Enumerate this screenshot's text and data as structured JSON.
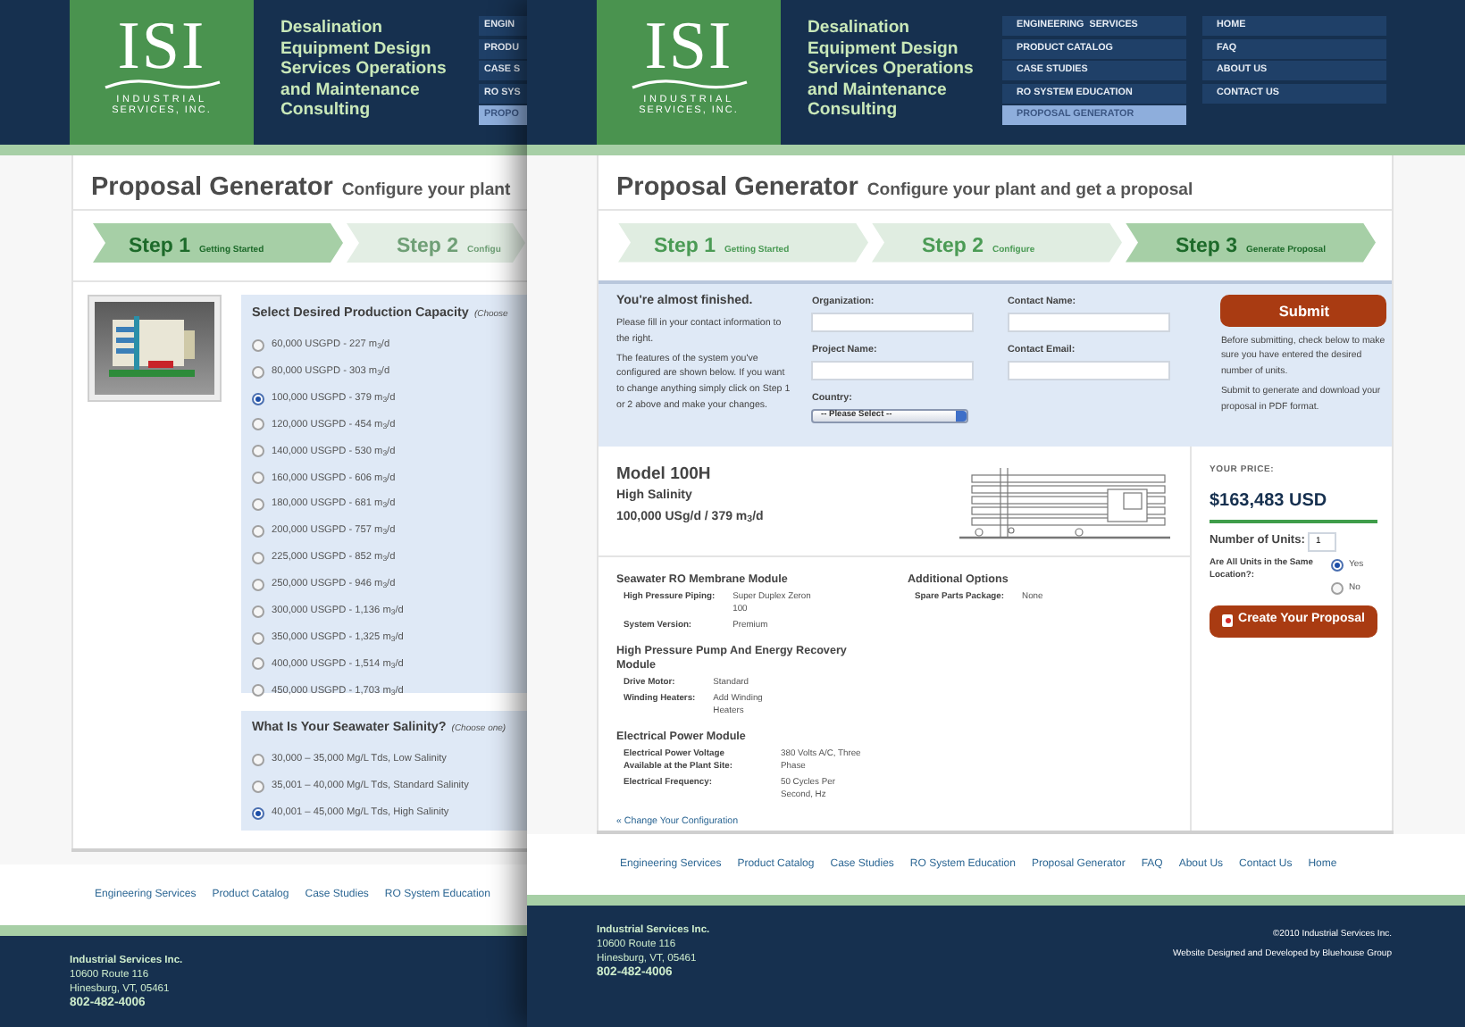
{
  "back_page": {
    "logo": {
      "letters": "ISI",
      "line_1": "INDUSTRIAL",
      "line_2": "SERVICES, INC."
    },
    "tagline": "Desalination Equipment Design Services Operations and Maintenance Consulting",
    "nav": [
      {
        "label": "ENGIN",
        "selected": false
      },
      {
        "label": "PRODU",
        "selected": false
      },
      {
        "label": "CASE S",
        "selected": false
      },
      {
        "label": "RO SYS",
        "selected": false
      },
      {
        "label": "PROPO",
        "selected": true
      }
    ],
    "title": "Proposal Generator",
    "subtitle": "Configure your plant",
    "steps": [
      {
        "label": "Step 1",
        "caption": "Getting Started",
        "selected": true
      },
      {
        "label": "Step 2",
        "caption": "Configu",
        "selected": false
      }
    ],
    "capacity": {
      "heading": "Select Desired Production Capacity",
      "hint": "(Choose",
      "options": [
        {
          "label": "60,000 USGPD - 227 m$_{3}$/d",
          "selected": false
        },
        {
          "label": "80,000 USGPD - 303 m$_{3}$/d",
          "selected": false
        },
        {
          "label": "100,000 USGPD - 379 m$_{3}$/d",
          "selected": true
        },
        {
          "label": "120,000 USGPD - 454 m$_{3}$/d",
          "selected": false
        },
        {
          "label": "140,000 USGPD - 530 m$_{3}$/d",
          "selected": false
        },
        {
          "label": "160,000 USGPD - 606 m$_{3}$/d",
          "selected": false
        },
        {
          "label": "180,000 USGPD - 681 m$_{3}$/d",
          "selected": false
        },
        {
          "label": "200,000 USGPD - 757 m$_{3}$/d",
          "selected": false
        },
        {
          "label": "225,000 USGPD - 852 m$_{3}$/d",
          "selected": false
        },
        {
          "label": "250,000 USGPD - 946 m$_{3}$/d",
          "selected": false
        },
        {
          "label": "300,000 USGPD - 1,136 m$_{3}$/d",
          "selected": false
        },
        {
          "label": "350,000 USGPD - 1,325 m$_{3}$/d",
          "selected": false
        },
        {
          "label": "400,000 USGPD - 1,514 m$_{3}$/d",
          "selected": false
        },
        {
          "label": "450,000 USGPD - 1,703 m$_{3}$/d",
          "selected": false
        }
      ]
    },
    "salinity": {
      "heading": "What Is Your Seawater Salinity?",
      "hint": "(Choose one)",
      "options": [
        {
          "label": "30,000 – 35,000 Mg/L Tds, Low Salinity",
          "selected": false
        },
        {
          "label": "35,001 – 40,000 Mg/L Tds, Standard Salinity",
          "selected": false
        },
        {
          "label": "40,001 – 45,000 Mg/L Tds, High Salinity",
          "selected": true
        }
      ]
    },
    "footer_links": [
      "Engineering Services",
      "Product Catalog",
      "Case Studies",
      "RO System Education"
    ],
    "address": {
      "company": "Industrial Services Inc.",
      "street": "10600 Route 116",
      "city": "Hinesburg, VT, 05461",
      "phone": "802-482-4006"
    }
  },
  "front_page": {
    "logo": {
      "letters": "ISI",
      "line_1": "INDUSTRIAL",
      "line_2": "SERVICES, INC."
    },
    "tagline": "Desalination Equipment Design Services Operations and Maintenance Consulting",
    "nav": [
      {
        "label": "ENGINEERING  SERVICES",
        "selected": false
      },
      {
        "label": "PRODUCT CATALOG",
        "selected": false
      },
      {
        "label": "CASE STUDIES",
        "selected": false
      },
      {
        "label": "RO SYSTEM EDUCATION",
        "selected": false
      },
      {
        "label": "PROPOSAL GENERATOR",
        "selected": true
      }
    ],
    "nav_2": [
      {
        "label": "HOME",
        "selected": false
      },
      {
        "label": "FAQ",
        "selected": false
      },
      {
        "label": "ABOUT US",
        "selected": false
      },
      {
        "label": "CONTACT US",
        "selected": false
      }
    ],
    "title": "Proposal Generator",
    "subtitle": "Configure your plant and get a proposal",
    "steps": [
      {
        "label": "Step 1",
        "caption": "Getting Started",
        "selected": false
      },
      {
        "label": "Step 2",
        "caption": "Configure",
        "selected": false
      },
      {
        "label": "Step 3",
        "caption": "Generate Proposal",
        "selected": true
      }
    ],
    "form": {
      "heading": "You're almost finished.",
      "paragraphs": [
        "Please fill in your contact information to the right.",
        "The features of the system you've configured are shown below. If you want to change anything simply click on Step 1 or 2 above and make your changes."
      ],
      "fields": [
        {
          "label": "Organization:",
          "kind": "text"
        },
        {
          "label": "Project Name:",
          "kind": "text"
        },
        {
          "label": "Country:",
          "kind": "select",
          "value": "-- Please Select --"
        },
        {
          "label": "Contact Name:",
          "kind": "text"
        },
        {
          "label": "Contact Email:",
          "kind": "text"
        }
      ],
      "submit": "Submit",
      "notes": [
        "Before submitting, check below to make sure you have entered the desired number of units.",
        "Submit to generate and download your proposal in PDF format."
      ]
    },
    "model": {
      "name": "Model 100H",
      "variant": "High Salinity",
      "capacity": "100,000 USg/d / 379 m$_{3}$/d"
    },
    "specs": [
      [
        {
          "title": "Seawater RO Membrane Module",
          "rows": [
            {
              "label": "High Pressure Piping:",
              "value": "Super Duplex Zeron 100"
            },
            {
              "label": "System Version:",
              "value": "Premium"
            }
          ]
        },
        {
          "title": "High Pressure Pump And Energy Recovery Module",
          "rows": [
            {
              "label": "Drive Motor:",
              "value": "Standard"
            },
            {
              "label": "Winding Heaters:",
              "value": "Add Winding Heaters"
            }
          ]
        },
        {
          "title": "Electrical Power Module",
          "rows": [
            {
              "label": "Electrical Power Voltage Available at the Plant Site:",
              "value": "380 Volts A/C, Three Phase"
            },
            {
              "label": "Electrical Frequency:",
              "value": "50 Cycles Per Second, Hz"
            }
          ]
        }
      ],
      [
        {
          "title": "Additional Options",
          "rows": [
            {
              "label": "Spare Parts Package:",
              "value": "None"
            }
          ]
        }
      ]
    ],
    "change_link": "« Change Your Configuration",
    "price": {
      "caption": "YOUR PRICE:",
      "amount": "$163,483 USD",
      "units_label": "Number of Units:",
      "units_value": "1",
      "location_question": "Are All Units in the Same Location?:",
      "location_options": [
        {
          "label": "Yes",
          "selected": true
        },
        {
          "label": "No",
          "selected": false
        }
      ],
      "button": "Create Your Proposal"
    },
    "footer_links": [
      "Engineering Services",
      "Product Catalog",
      "Case Studies",
      "RO System Education",
      "Proposal Generator",
      "FAQ",
      "About Us",
      "Contact Us",
      "Home"
    ],
    "address": {
      "company": "Industrial Services Inc.",
      "street": "10600 Route 116",
      "city": "Hinesburg, VT, 05461",
      "phone": "802-482-4006"
    },
    "copyright": "©2010 Industrial Services Inc.",
    "credit": "Website Designed and Developed by Bluehouse Group"
  }
}
